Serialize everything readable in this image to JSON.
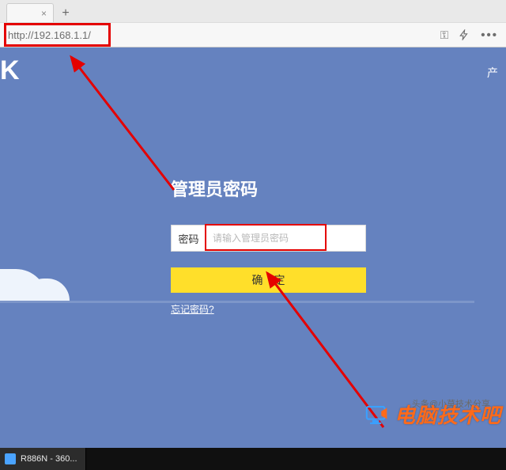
{
  "browser": {
    "tab_close": "×",
    "new_tab": "+",
    "url": "http://192.168.1.1/",
    "icons": {
      "key": "⚿",
      "dots": "•••"
    }
  },
  "page": {
    "logo_fragment": "K",
    "nav_right_fragment": "产",
    "login": {
      "title": "管理员密码",
      "pw_label": "密码",
      "pw_placeholder": "请输入管理员密码",
      "submit": "确定",
      "forgot": "忘记密码?"
    }
  },
  "taskbar": {
    "item1": "R886N - 360..."
  },
  "watermark": {
    "text": "电脑技术吧",
    "tagline": "头条@小莫技术分享"
  },
  "annotation": {
    "highlight_color": "#e40000"
  }
}
